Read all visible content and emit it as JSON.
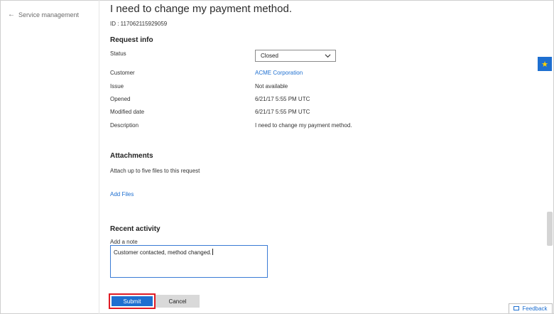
{
  "nav": {
    "back_label": "Service management"
  },
  "request": {
    "title": "I need to change my payment method.",
    "id_text": "ID : 117062115929059"
  },
  "request_info": {
    "heading": "Request info",
    "status_label": "Status",
    "status_value": "Closed",
    "customer_label": "Customer",
    "customer_value": "ACME Corporation",
    "issue_label": "Issue",
    "issue_value": "Not available",
    "opened_label": "Opened",
    "opened_value": "6/21/17 5:55 PM UTC",
    "modified_label": "Modified date",
    "modified_value": "6/21/17 5:55 PM UTC",
    "description_label": "Description",
    "description_value": "I need to change my payment method."
  },
  "attachments": {
    "heading": "Attachments",
    "hint": "Attach up to five files to this request",
    "add_files": "Add Files"
  },
  "activity": {
    "heading": "Recent activity",
    "note_label": "Add a note",
    "note_value": "Customer contacted, method changed."
  },
  "actions": {
    "submit_label": "Submit",
    "cancel_label": "Cancel"
  },
  "side": {
    "star_icon": "star-icon",
    "feedback_label": "Feedback"
  },
  "colors": {
    "accent": "#1e6fd0",
    "highlight": "#e01b24",
    "cancel_bg": "#d9d9d9",
    "star": "#ffd200"
  }
}
